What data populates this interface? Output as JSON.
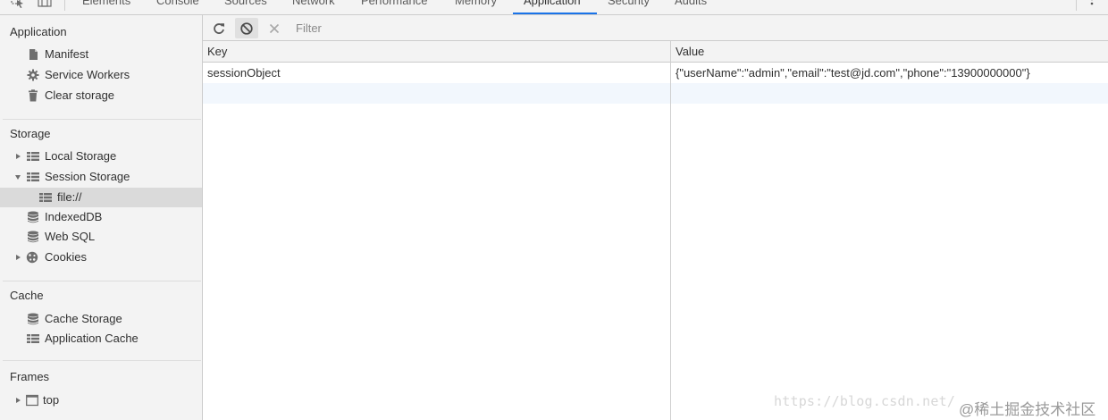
{
  "tabs": [
    {
      "label": "Elements",
      "active": false
    },
    {
      "label": "Console",
      "active": false
    },
    {
      "label": "Sources",
      "active": false
    },
    {
      "label": "Network",
      "active": false
    },
    {
      "label": "Performance",
      "active": false
    },
    {
      "label": "Memory",
      "active": false
    },
    {
      "label": "Application",
      "active": true
    },
    {
      "label": "Security",
      "active": false
    },
    {
      "label": "Audits",
      "active": false
    }
  ],
  "sidebar": {
    "application": {
      "header": "Application",
      "items": [
        {
          "label": "Manifest",
          "icon": "document-icon"
        },
        {
          "label": "Service Workers",
          "icon": "gear-icon"
        },
        {
          "label": "Clear storage",
          "icon": "trash-icon"
        }
      ]
    },
    "storage": {
      "header": "Storage",
      "items": [
        {
          "label": "Local Storage",
          "icon": "grid-icon",
          "expanded": false
        },
        {
          "label": "Session Storage",
          "icon": "grid-icon",
          "expanded": true
        },
        {
          "label": "file://",
          "icon": "grid-icon",
          "selected": true
        },
        {
          "label": "IndexedDB",
          "icon": "database-icon"
        },
        {
          "label": "Web SQL",
          "icon": "database-icon"
        },
        {
          "label": "Cookies",
          "icon": "cookie-icon",
          "expanded": false
        }
      ]
    },
    "cache": {
      "header": "Cache",
      "items": [
        {
          "label": "Cache Storage",
          "icon": "database-icon"
        },
        {
          "label": "Application Cache",
          "icon": "grid-icon"
        }
      ]
    },
    "frames": {
      "header": "Frames",
      "items": [
        {
          "label": "top",
          "icon": "frame-icon",
          "expanded": false
        }
      ]
    }
  },
  "toolbar": {
    "filter_placeholder": "Filter",
    "filter_value": ""
  },
  "table": {
    "columns": [
      "Key",
      "Value"
    ],
    "rows": [
      {
        "key": "sessionObject",
        "value": "{\"userName\":\"admin\",\"email\":\"test@jd.com\",\"phone\":\"13900000000\"}"
      }
    ]
  },
  "watermark": {
    "url": "https://blog.csdn.net/",
    "site": "@稀土掘金技术社区"
  },
  "colors": {
    "accent": "#1a73e8",
    "selected_bg": "#dadada",
    "panel_bg": "#f3f3f3",
    "alt_row": "#f2f7fd"
  }
}
